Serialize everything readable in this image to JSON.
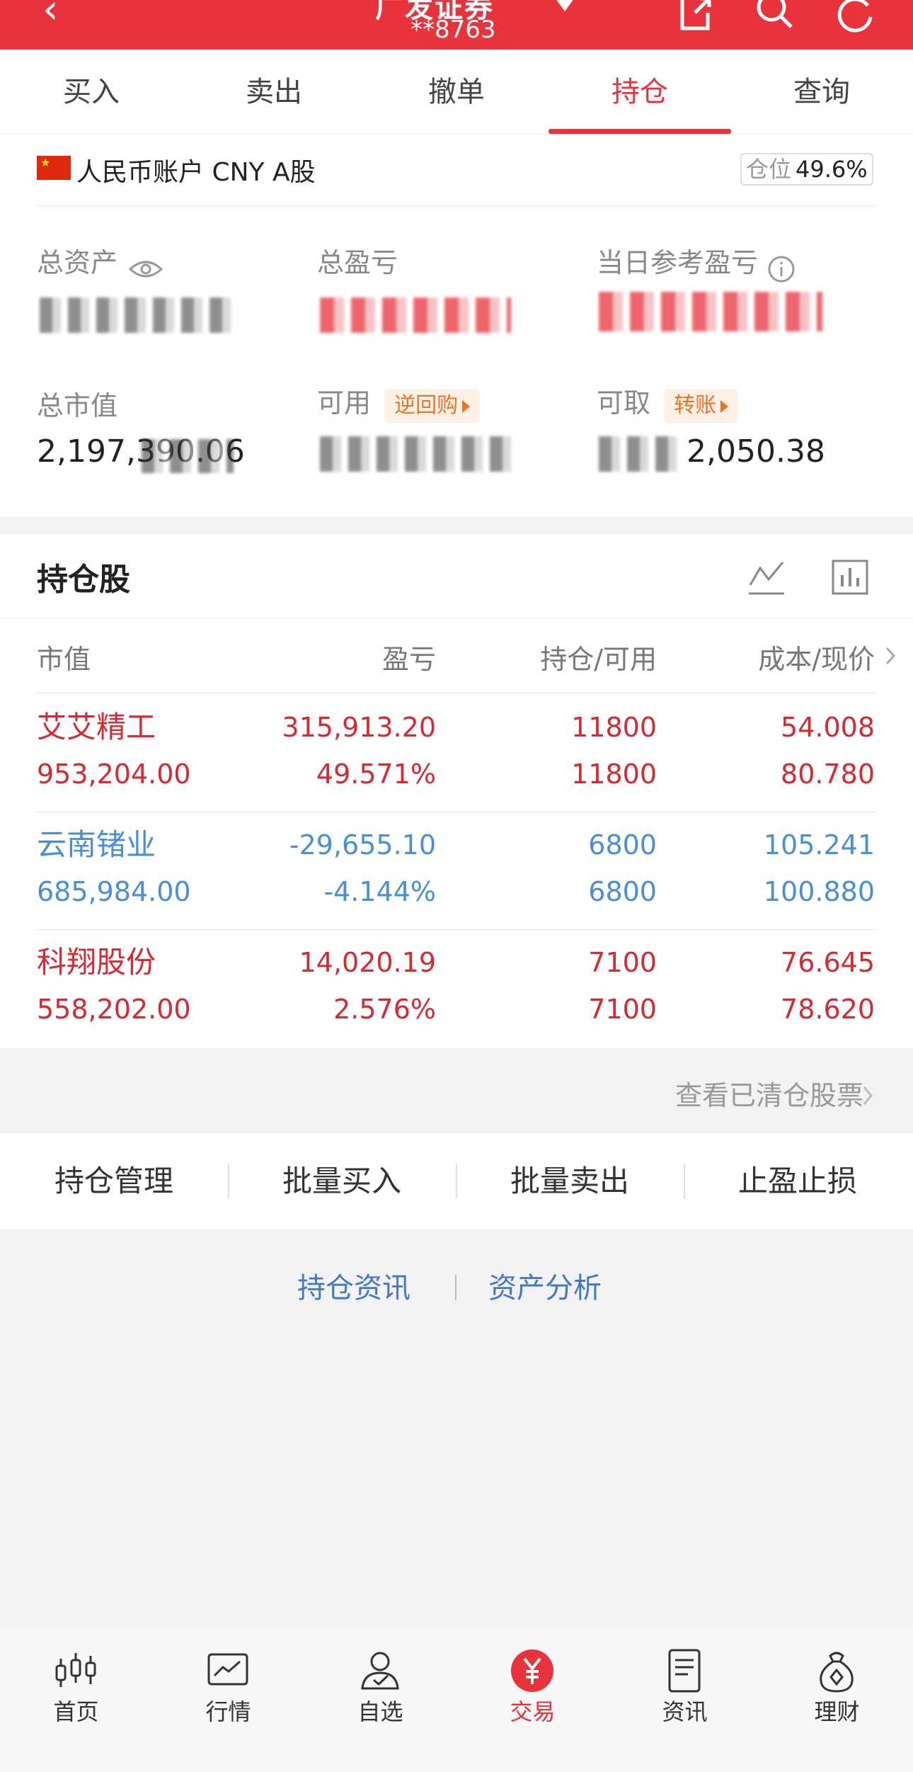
{
  "header": {
    "title": "广发证券",
    "account_masked": "**8763"
  },
  "tabs": [
    {
      "label": "买入",
      "active": false
    },
    {
      "label": "卖出",
      "active": false
    },
    {
      "label": "撤单",
      "active": false
    },
    {
      "label": "持仓",
      "active": true
    },
    {
      "label": "查询",
      "active": false
    }
  ],
  "account": {
    "name": "人民币账户 CNY A股",
    "position_label": "仓位",
    "position_value": "49.6%",
    "total_assets_label": "总资产",
    "total_pl_label": "总盈亏",
    "daily_pl_label": "当日参考盈亏",
    "market_value_label": "总市值",
    "market_value": "2,197,390.06",
    "available_label": "可用",
    "reverse_repo_label": "逆回购",
    "withdrawable_label": "可取",
    "transfer_label": "转账",
    "withdrawable_tail": "2,050.38"
  },
  "holdings": {
    "title": "持仓股",
    "columns": [
      "市值",
      "盈亏",
      "持仓/可用",
      "成本/现价"
    ],
    "rows": [
      {
        "name": "艾艾精工",
        "market_value": "953,204.00",
        "pl": "315,913.20",
        "pl_pct": "49.571%",
        "hold": "11800",
        "avail": "11800",
        "cost": "54.008",
        "price": "80.780",
        "color": "#d42a33"
      },
      {
        "name": "云南锗业",
        "market_value": "685,984.00",
        "pl": "-29,655.10",
        "pl_pct": "-4.144%",
        "hold": "6800",
        "avail": "6800",
        "cost": "105.241",
        "price": "100.880",
        "color": "#4a8fd4"
      },
      {
        "name": "科翔股份",
        "market_value": "558,202.00",
        "pl": "14,020.19",
        "pl_pct": "2.576%",
        "hold": "7100",
        "avail": "7100",
        "cost": "76.645",
        "price": "78.620",
        "color": "#d42a33"
      }
    ],
    "view_cleared": "查看已清仓股票"
  },
  "actions": [
    "持仓管理",
    "批量买入",
    "批量卖出",
    "止盈止损"
  ],
  "links": [
    "持仓资讯",
    "资产分析"
  ],
  "nav": [
    {
      "label": "首页",
      "icon": "candlestick-icon",
      "active": false
    },
    {
      "label": "行情",
      "icon": "chart-icon",
      "active": false
    },
    {
      "label": "自选",
      "icon": "user-check-icon",
      "active": false
    },
    {
      "label": "交易",
      "icon": "yuan-icon",
      "active": true
    },
    {
      "label": "资讯",
      "icon": "document-icon",
      "active": false
    },
    {
      "label": "理财",
      "icon": "money-bag-icon",
      "active": false
    }
  ],
  "colors": {
    "brand_red": "#e8323c",
    "loss_blue": "#4a8fd4",
    "pill_orange": "#e8742a"
  }
}
